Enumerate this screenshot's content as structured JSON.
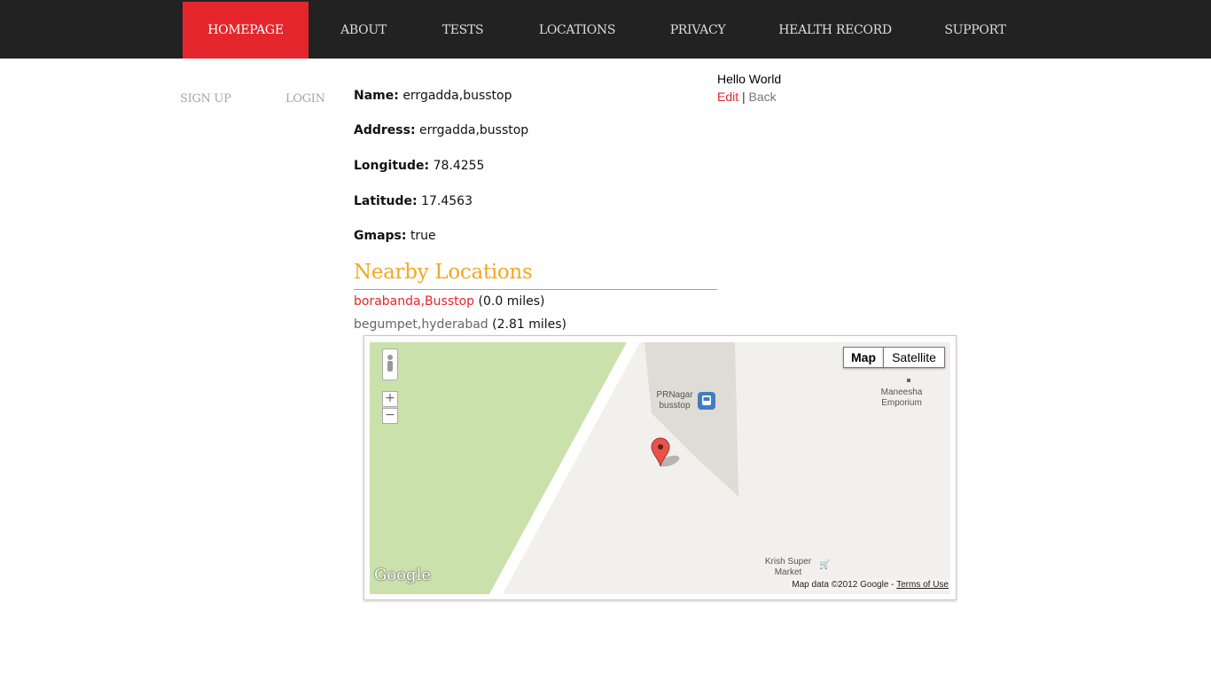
{
  "nav": {
    "items": [
      "HOMEPAGE",
      "ABOUT",
      "TESTS",
      "LOCATIONS",
      "PRIVACY",
      "HEALTH RECORD",
      "SUPPORT"
    ],
    "active": "HOMEPAGE",
    "active_color": "#e5262c",
    "bar_color": "#222222"
  },
  "sidebar": {
    "signup": "SIGN UP",
    "login": "LOGIN"
  },
  "greeting": {
    "text": "Hello World",
    "edit": "Edit",
    "separator": " | ",
    "back": "Back"
  },
  "details": {
    "name_label": "Name:",
    "name_value": "errgadda,busstop",
    "address_label": "Address:",
    "address_value": "errgadda,busstop",
    "longitude_label": "Longitude:",
    "longitude_value": "78.4255",
    "latitude_label": "Latitude:",
    "latitude_value": "17.4563",
    "gmaps_label": "Gmaps:",
    "gmaps_value": "true"
  },
  "nearby": {
    "title": "Nearby Locations",
    "title_color": "#f5a623",
    "items": [
      {
        "name": "borabanda,Busstop",
        "distance": "(0.0 miles)",
        "color": "#e5262c"
      },
      {
        "name": "begumpet,hyderabad",
        "distance": "(2.81 miles)",
        "color": "#666666"
      }
    ]
  },
  "map": {
    "type_map": "Map",
    "type_satellite": "Satellite",
    "zoom_in": "+",
    "zoom_out": "−",
    "labels": {
      "busstop": "PRNagar busstop",
      "emporium": "Maneesha Emporium",
      "market": "Krish Super Market"
    },
    "logo": "Google",
    "attribution": "Map data ©2012 Google - ",
    "terms": "Terms of Use",
    "park_color": "#cbe1ab",
    "land_color": "#f2f0ec",
    "marker_color": "#e9524a"
  }
}
